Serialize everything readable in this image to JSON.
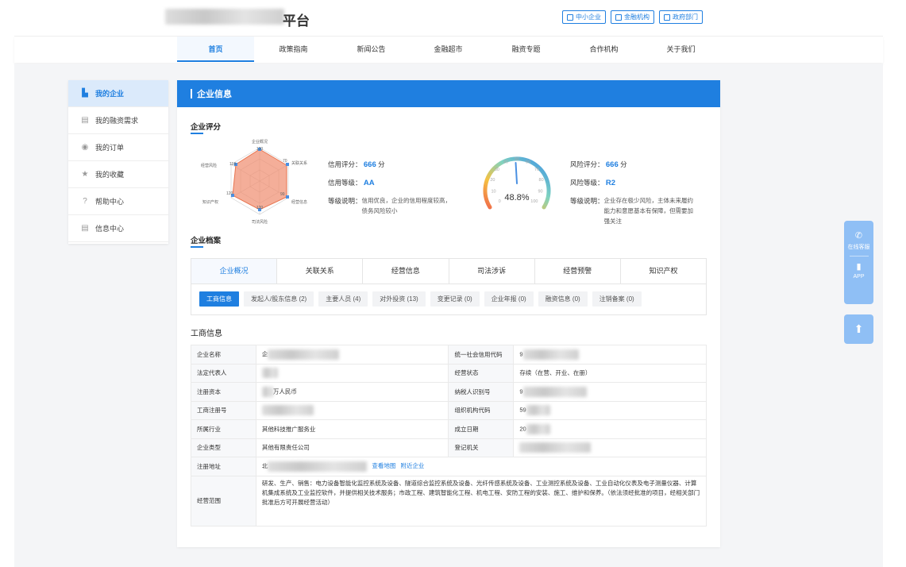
{
  "header": {
    "site_title_visible": "平台",
    "buttons": [
      {
        "label": "中小企业",
        "icon": "building-icon"
      },
      {
        "label": "金融机构",
        "icon": "bank-user-icon"
      },
      {
        "label": "政府部门",
        "icon": "government-icon"
      }
    ]
  },
  "nav": {
    "items": [
      "首页",
      "政策指南",
      "新闻公告",
      "金融超市",
      "融资专题",
      "合作机构",
      "关于我们"
    ],
    "active": "首页"
  },
  "sidebar": {
    "items": [
      {
        "label": "我的企业",
        "icon": "building-icon",
        "active": true
      },
      {
        "label": "我的融资需求",
        "icon": "document-icon",
        "active": false
      },
      {
        "label": "我的订单",
        "icon": "order-icon",
        "active": false
      },
      {
        "label": "我的收藏",
        "icon": "star-icon",
        "active": false
      },
      {
        "label": "帮助中心",
        "icon": "help-icon",
        "active": false
      },
      {
        "label": "信息中心",
        "icon": "info-list-icon",
        "active": false
      }
    ]
  },
  "main": {
    "title": "企业信息",
    "score_section": "企业评分",
    "radar": {
      "axes": [
        {
          "label": "企业概况",
          "value": "120"
        },
        {
          "label": "关联关系",
          "value": "70"
        },
        {
          "label": "经营信息",
          "value": "99"
        },
        {
          "label": "司法风险",
          "value": "120"
        },
        {
          "label": "知识产权",
          "value": "120"
        },
        {
          "label": "经营风险",
          "value": "118"
        }
      ]
    },
    "credit": {
      "score_label": "信用评分：",
      "score": "666",
      "score_unit": "分",
      "level_label": "信用等级：",
      "level": "AA",
      "desc_label": "等级说明：",
      "desc": "信用优良，企业的信用程度较高，债务风险较小"
    },
    "gauge": {
      "value_text": "48.8%",
      "value": 48.8,
      "ticks": [
        "0",
        "10",
        "20",
        "30",
        "40",
        "50",
        "60",
        "70",
        "80",
        "90",
        "100"
      ]
    },
    "risk": {
      "score_label": "风险评分：",
      "score": "666",
      "score_unit": "分",
      "level_label": "风险等级：",
      "level": "R2",
      "desc_label": "等级说明：",
      "desc": "企业存在极少风险，主体未来履约能力和意愿基本有保障，但需要加强关注"
    },
    "archive_section": "企业档案",
    "tabs": [
      "企业概况",
      "关联关系",
      "经营信息",
      "司法涉诉",
      "经营预警",
      "知识产权"
    ],
    "active_tab": "企业概况",
    "subtabs": [
      "工商信息",
      "发起人/股东信息 (2)",
      "主要人员 (4)",
      "对外投资 (13)",
      "变更记录 (0)",
      "企业年报 (0)",
      "融资信息 (0)",
      "注销备案 (0)"
    ],
    "active_subtab": "工商信息",
    "business_section": "工商信息",
    "table": {
      "rows": [
        [
          {
            "k": "企业名称",
            "v": "企"
          },
          {
            "k": "统一社会信用代码",
            "v": "9"
          }
        ],
        [
          {
            "k": "法定代表人",
            "v": ""
          },
          {
            "k": "经营状态",
            "v": "存续（在营、开业、在册）"
          }
        ],
        [
          {
            "k": "注册资本",
            "v": "万人民币"
          },
          {
            "k": "纳税人识别号",
            "v": "9"
          }
        ],
        [
          {
            "k": "工商注册号",
            "v": ""
          },
          {
            "k": "组织机构代码",
            "v": "59"
          }
        ],
        [
          {
            "k": "所属行业",
            "v": "其他科技推广服务业"
          },
          {
            "k": "成立日期",
            "v": "20"
          }
        ],
        [
          {
            "k": "企业类型",
            "v": "其他有限责任公司"
          },
          {
            "k": "登记机关",
            "v": ""
          }
        ]
      ],
      "address_label": "注册地址",
      "address_value": "北",
      "address_link1": "查看地图",
      "address_link2": "附近企业",
      "scope_label": "经营范围",
      "scope_value": "研发、生产、销售：电力设备智能化监控系统及设备、隧道综合监控系统及设备、光纤传感系统及设备、工业测控系统及设备、工业自动化仪表及电子测量仪器、计算机集成系统及工业监控软件，并提供相关技术服务；市政工程、建筑智能化工程、机电工程、安防工程的安装、施工、维护和保养。（依法须经批准的项目，经相关部门批准后方可开展经营活动）"
    }
  },
  "float": {
    "service_label": "在线客服",
    "app_label": "APP"
  }
}
